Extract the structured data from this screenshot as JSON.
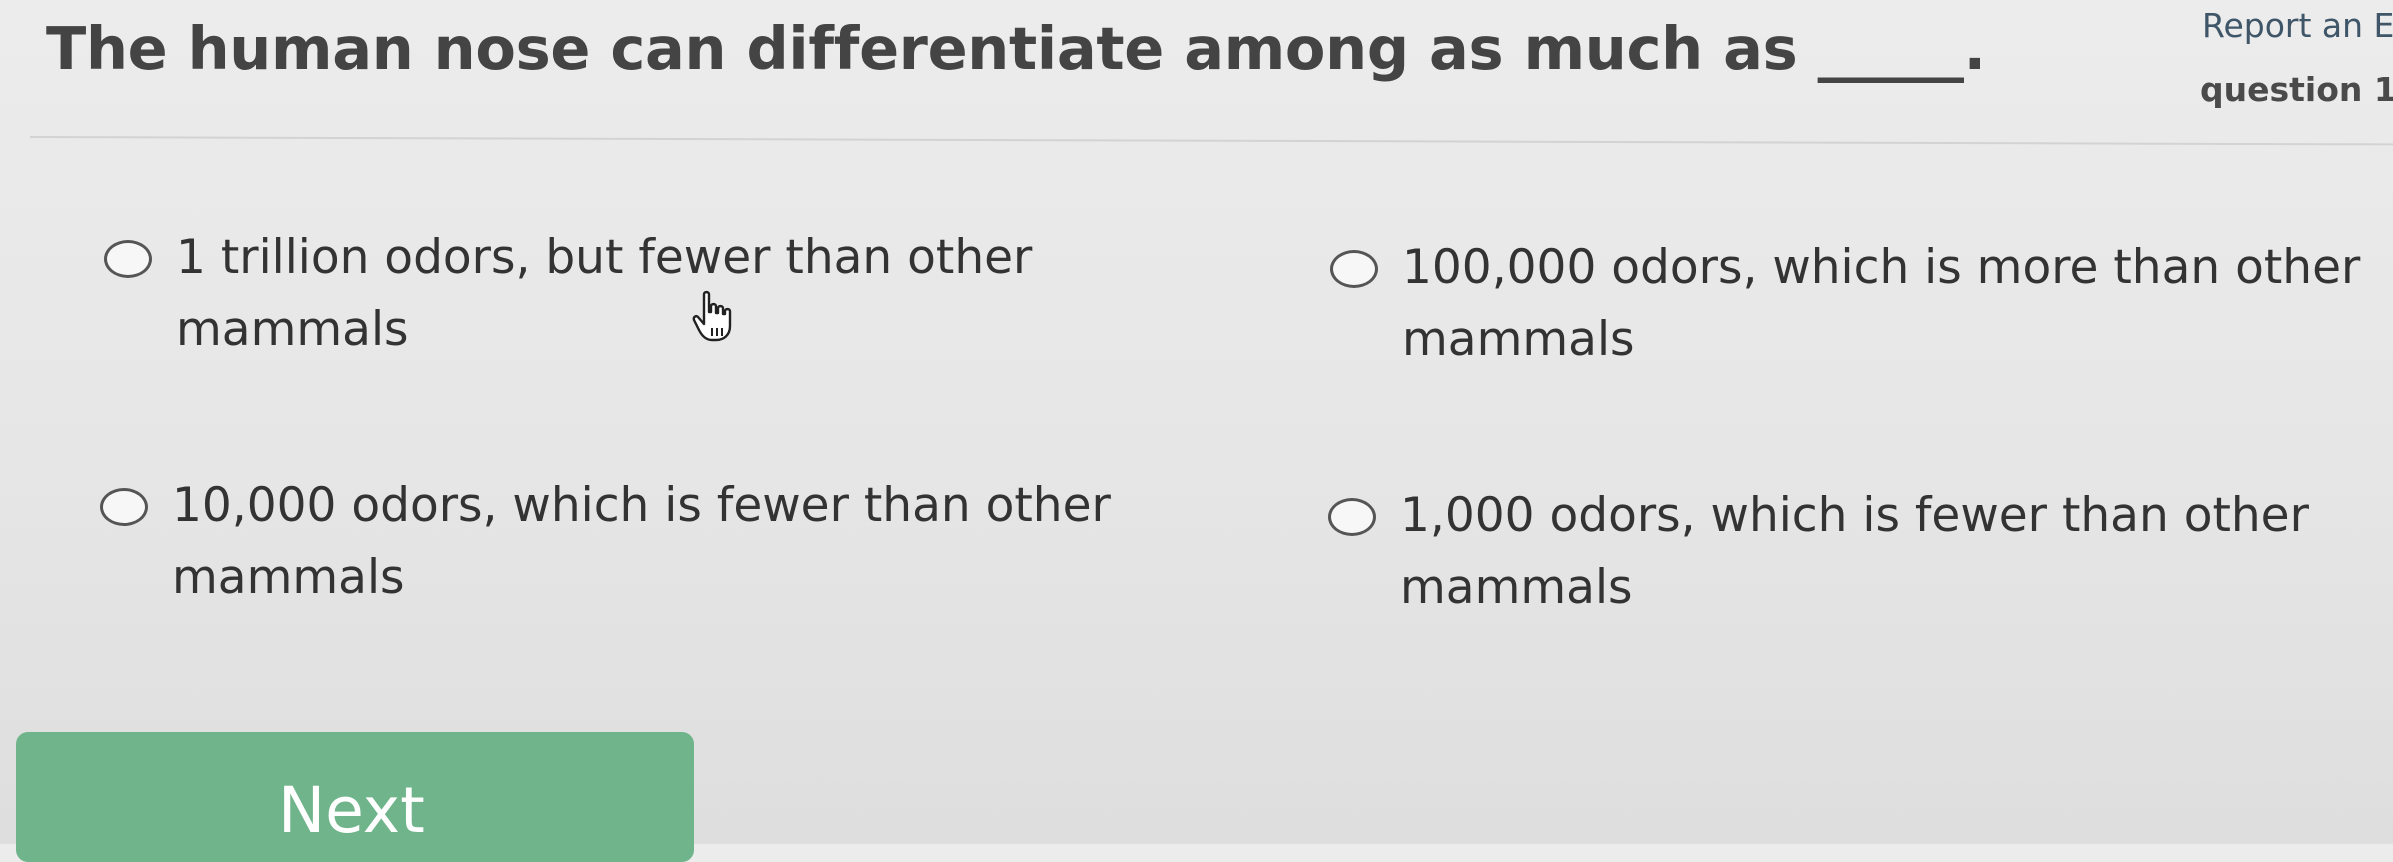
{
  "question": {
    "text": "The human nose can differentiate among as much as _____."
  },
  "header": {
    "report_link": "Report an Er",
    "question_number": "question 1"
  },
  "options": [
    {
      "text": "1 trillion odors, but fewer than other mammals",
      "selected": false
    },
    {
      "text": "100,000 odors, which is more than other mammals",
      "selected": false
    },
    {
      "text": "10,000 odors, which is fewer than other mammals",
      "selected": false
    },
    {
      "text": "1,000 odors, which is fewer than other mammals",
      "selected": false
    }
  ],
  "footer": {
    "next_label": "Next"
  },
  "colors": {
    "next_button": "#6fb48a",
    "report_link": "#3f5568"
  },
  "cursor": {
    "icon": "hand-pointer-icon"
  }
}
